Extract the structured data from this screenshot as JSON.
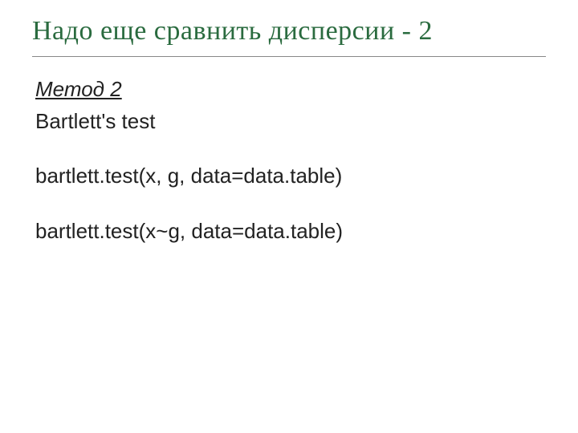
{
  "title": "Надо еще сравнить дисперсии - 2",
  "content": {
    "method_label": "Метод 2",
    "test_name": "Bartlett's test",
    "code_line_1": "bartlett.test(x, g, data=data.table)",
    "code_line_2": "bartlett.test(x~g, data=data.table)"
  }
}
